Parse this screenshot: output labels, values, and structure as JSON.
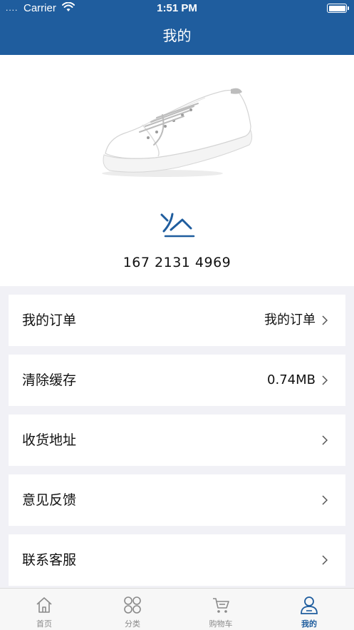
{
  "status_bar": {
    "signal": "....",
    "carrier": "Carrier",
    "time": "1:51 PM",
    "wifi_icon": "wifi-icon",
    "battery_icon": "battery-icon"
  },
  "header": {
    "title": "我的"
  },
  "profile": {
    "image": "sneaker-image",
    "logo": "brand-logo-icon",
    "phone": "167 2131 4969"
  },
  "menu": [
    {
      "label": "我的订单",
      "value": "我的订单"
    },
    {
      "label": "清除缓存",
      "value": "0.74MB"
    },
    {
      "label": "收货地址",
      "value": ""
    },
    {
      "label": "意见反馈",
      "value": ""
    },
    {
      "label": "联系客服",
      "value": ""
    }
  ],
  "tabbar": {
    "items": [
      {
        "label": "首页",
        "icon": "home-icon"
      },
      {
        "label": "分类",
        "icon": "category-icon"
      },
      {
        "label": "购物车",
        "icon": "cart-icon"
      },
      {
        "label": "我的",
        "icon": "user-icon"
      }
    ],
    "active_index": 3
  },
  "colors": {
    "primary": "#1f5d9e",
    "background": "#f1f1f6",
    "tab_inactive": "#8a8a8a"
  }
}
